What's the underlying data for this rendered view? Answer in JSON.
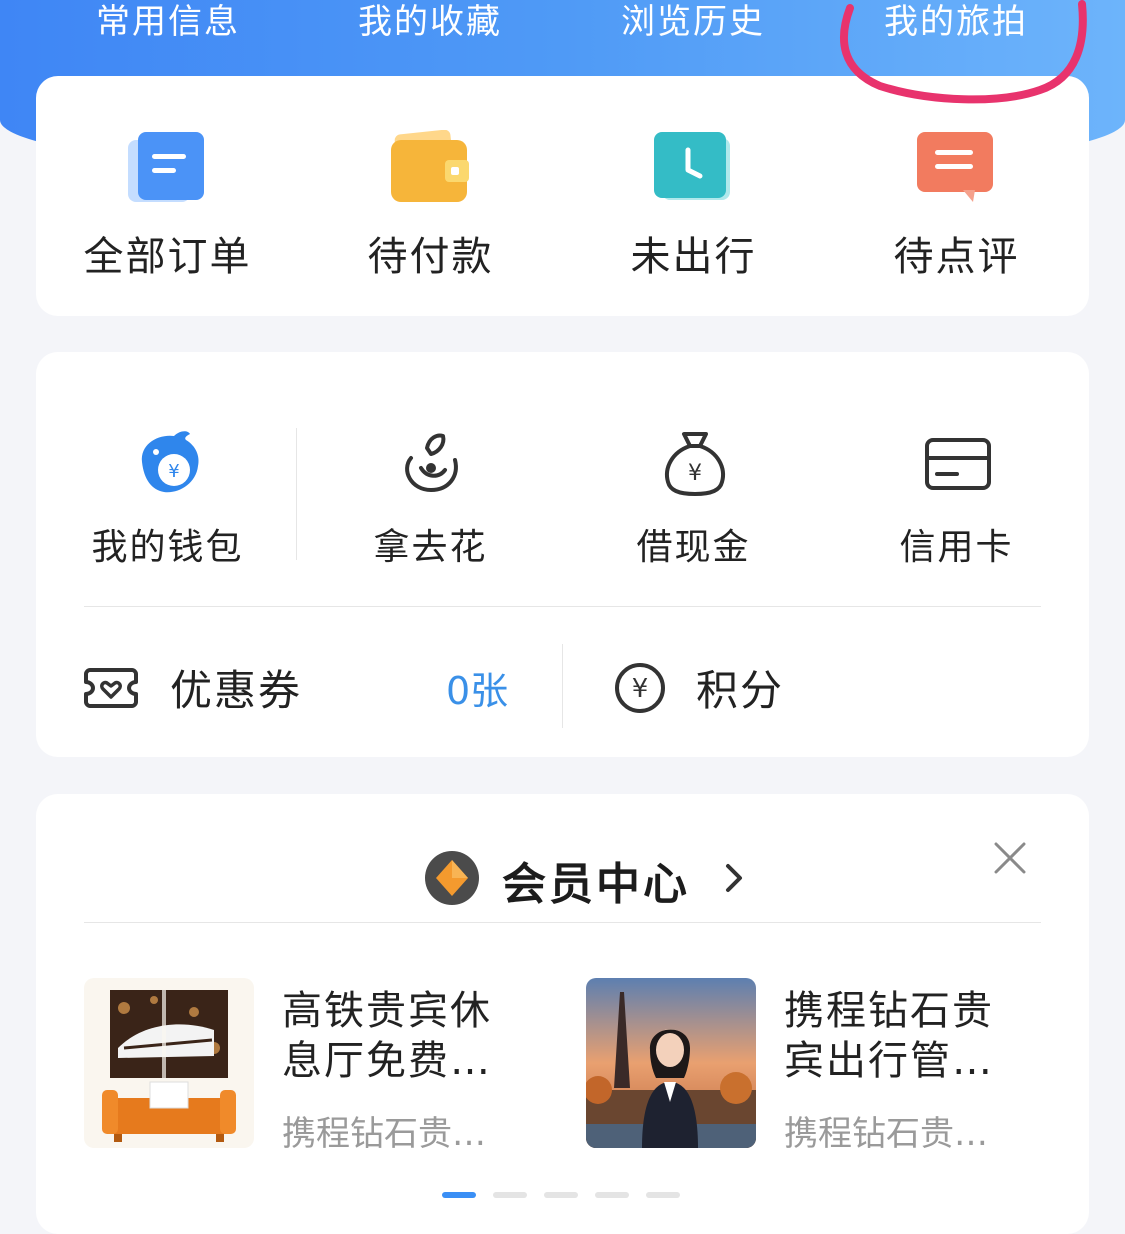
{
  "top_tabs": [
    "常用信息",
    "我的收藏",
    "浏览历史",
    "我的旅拍"
  ],
  "orders": [
    {
      "label": "全部订单",
      "icon": "document-icon"
    },
    {
      "label": "待付款",
      "icon": "wallet-icon"
    },
    {
      "label": "未出行",
      "icon": "clock-icon"
    },
    {
      "label": "待点评",
      "icon": "comment-icon"
    }
  ],
  "finance": [
    {
      "label": "我的钱包",
      "icon": "dolphin-wallet-icon"
    },
    {
      "label": "拿去花",
      "icon": "flower-icon"
    },
    {
      "label": "借现金",
      "icon": "money-bag-icon"
    },
    {
      "label": "信用卡",
      "icon": "credit-card-icon"
    }
  ],
  "coupon": {
    "label": "优惠券",
    "count": "0张"
  },
  "points": {
    "label": "积分"
  },
  "member": {
    "title": "会员中心",
    "promos": [
      {
        "title_line1": "高铁贵宾休",
        "title_line2": "息厅免费…",
        "subtitle": "携程钻石贵…"
      },
      {
        "title_line1": "携程钻石贵",
        "title_line2": "宾出行管…",
        "subtitle": "携程钻石贵…"
      }
    ],
    "carousel": {
      "total": 5,
      "active": 1
    }
  },
  "colors": {
    "brand_blue": "#3f86f5",
    "link_blue": "#3a90e8",
    "annotation": "#e8336d"
  }
}
